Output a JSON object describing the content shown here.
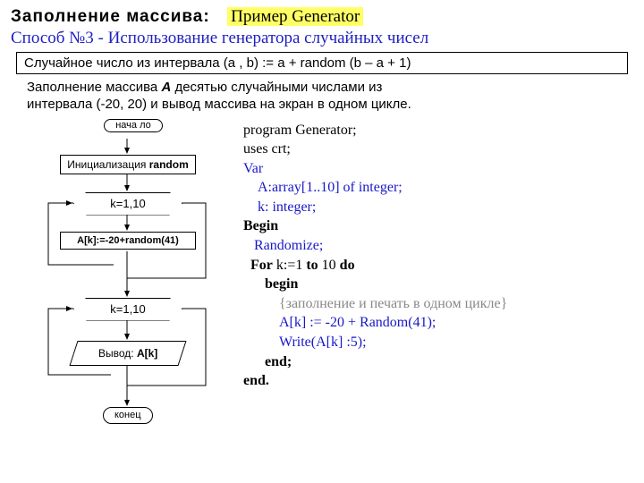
{
  "header": {
    "title_left": "Заполнение массива:",
    "title_hl": "Пример Generator",
    "subtitle": "Способ №3 - Использование генератора случайных чисел"
  },
  "formula": "Случайное число из интервала (a , b)  := a + random (b – a + 1)",
  "task": {
    "line1_a": "Заполнение массива ",
    "line1_b": "А ",
    "line1_c": " десятью случайными числами  из",
    "line2": "интервала (-20, 20) и вывод массива на экран в одном цикле."
  },
  "flow": {
    "start": "нача\nло",
    "init_a": "Инициализация ",
    "init_b": "random",
    "loop1": "k=1,10",
    "assign": "A[k]:=-20+random(41)",
    "loop2": "k=1,10",
    "out_a": "Вывод: ",
    "out_b": "A[k]",
    "end": "конец"
  },
  "code": {
    "l1": "program Generator;",
    "l2": "uses crt;",
    "l3": "Var",
    "l4": "A:array[1..10] of integer;",
    "l5": "k: integer;",
    "l6a": "Begin",
    "l7": "Randomize;",
    "l8a": "For",
    "l8b": "  k:=1 ",
    "l8c": "to",
    "l8d": " 10 ",
    "l8e": "do",
    "l9": "begin",
    "l10": "{заполнение  и печать в одном цикле}",
    "l11": "A[k] := -20 + Random(41);",
    "l12": "Write(A[k] :5);",
    "l13": "end;",
    "l14": "end."
  }
}
